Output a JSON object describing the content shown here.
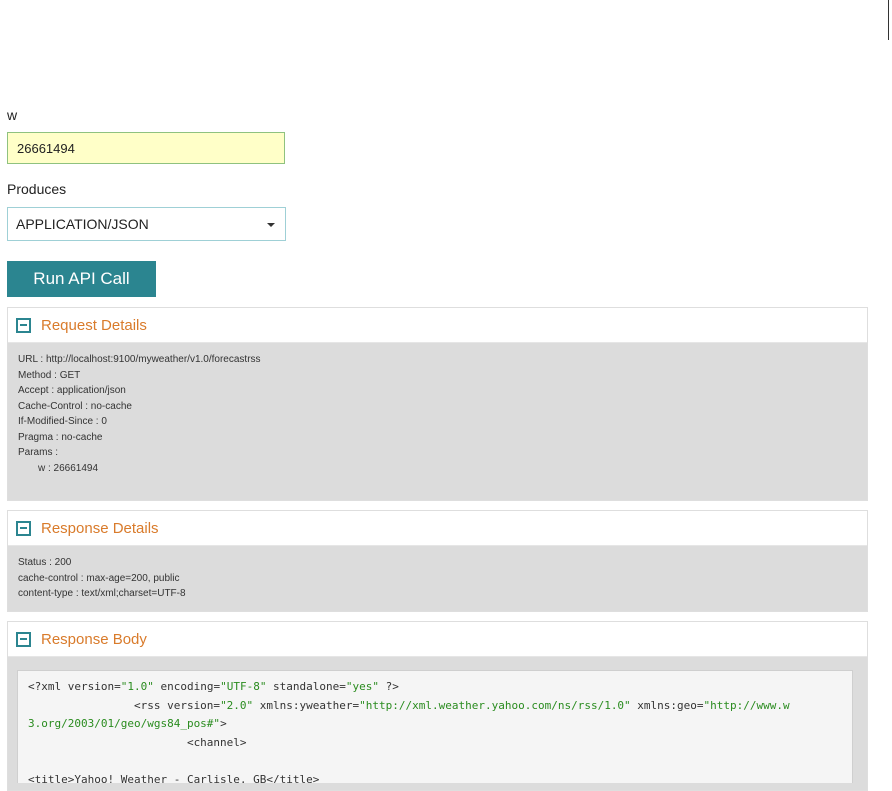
{
  "form": {
    "w_label": "w",
    "w_value": "26661494",
    "produces_label": "Produces",
    "produces_selected": "APPLICATION/JSON",
    "run_button": "Run API Call"
  },
  "request_details": {
    "title": "Request Details",
    "lines": [
      "URL : http://localhost:9100/myweather/v1.0/forecastrss",
      "Method : GET",
      "Accept : application/json",
      "Cache-Control : no-cache",
      "If-Modified-Since : 0",
      "Pragma : no-cache",
      "Params :"
    ],
    "param_line": "w : 26661494"
  },
  "response_details": {
    "title": "Response Details",
    "lines": [
      "Status : 200",
      "cache-control : max-age=200, public",
      "content-type : text/xml;charset=UTF-8"
    ]
  },
  "response_body": {
    "title": "Response Body",
    "code": {
      "l1_a": "<?xml version=",
      "l1_b": "\"1.0\"",
      "l1_c": " encoding=",
      "l1_d": "\"UTF-8\"",
      "l1_e": " standalone=",
      "l1_f": "\"yes\"",
      "l1_g": " ?>",
      "l2_a": "                <rss version=",
      "l2_b": "\"2.0\"",
      "l2_c": " xmlns:yweather=",
      "l2_d": "\"http://xml.weather.yahoo.com/ns/rss/1.0\"",
      "l2_e": " xmlns:geo=",
      "l2_f": "\"http://www.w",
      "l3_a": "3.org/2003/01/geo/wgs84_pos#\"",
      "l3_b": ">",
      "l4": "                        <channel>",
      "l5": "",
      "l6": "<title>Yahoo! Weather - Carlisle, GB</title>"
    }
  },
  "colors": {
    "accent": "#2b8590",
    "panel_title": "#d97b2b",
    "input_highlight": "#ffffc8",
    "code_string": "#2a8c1f"
  }
}
